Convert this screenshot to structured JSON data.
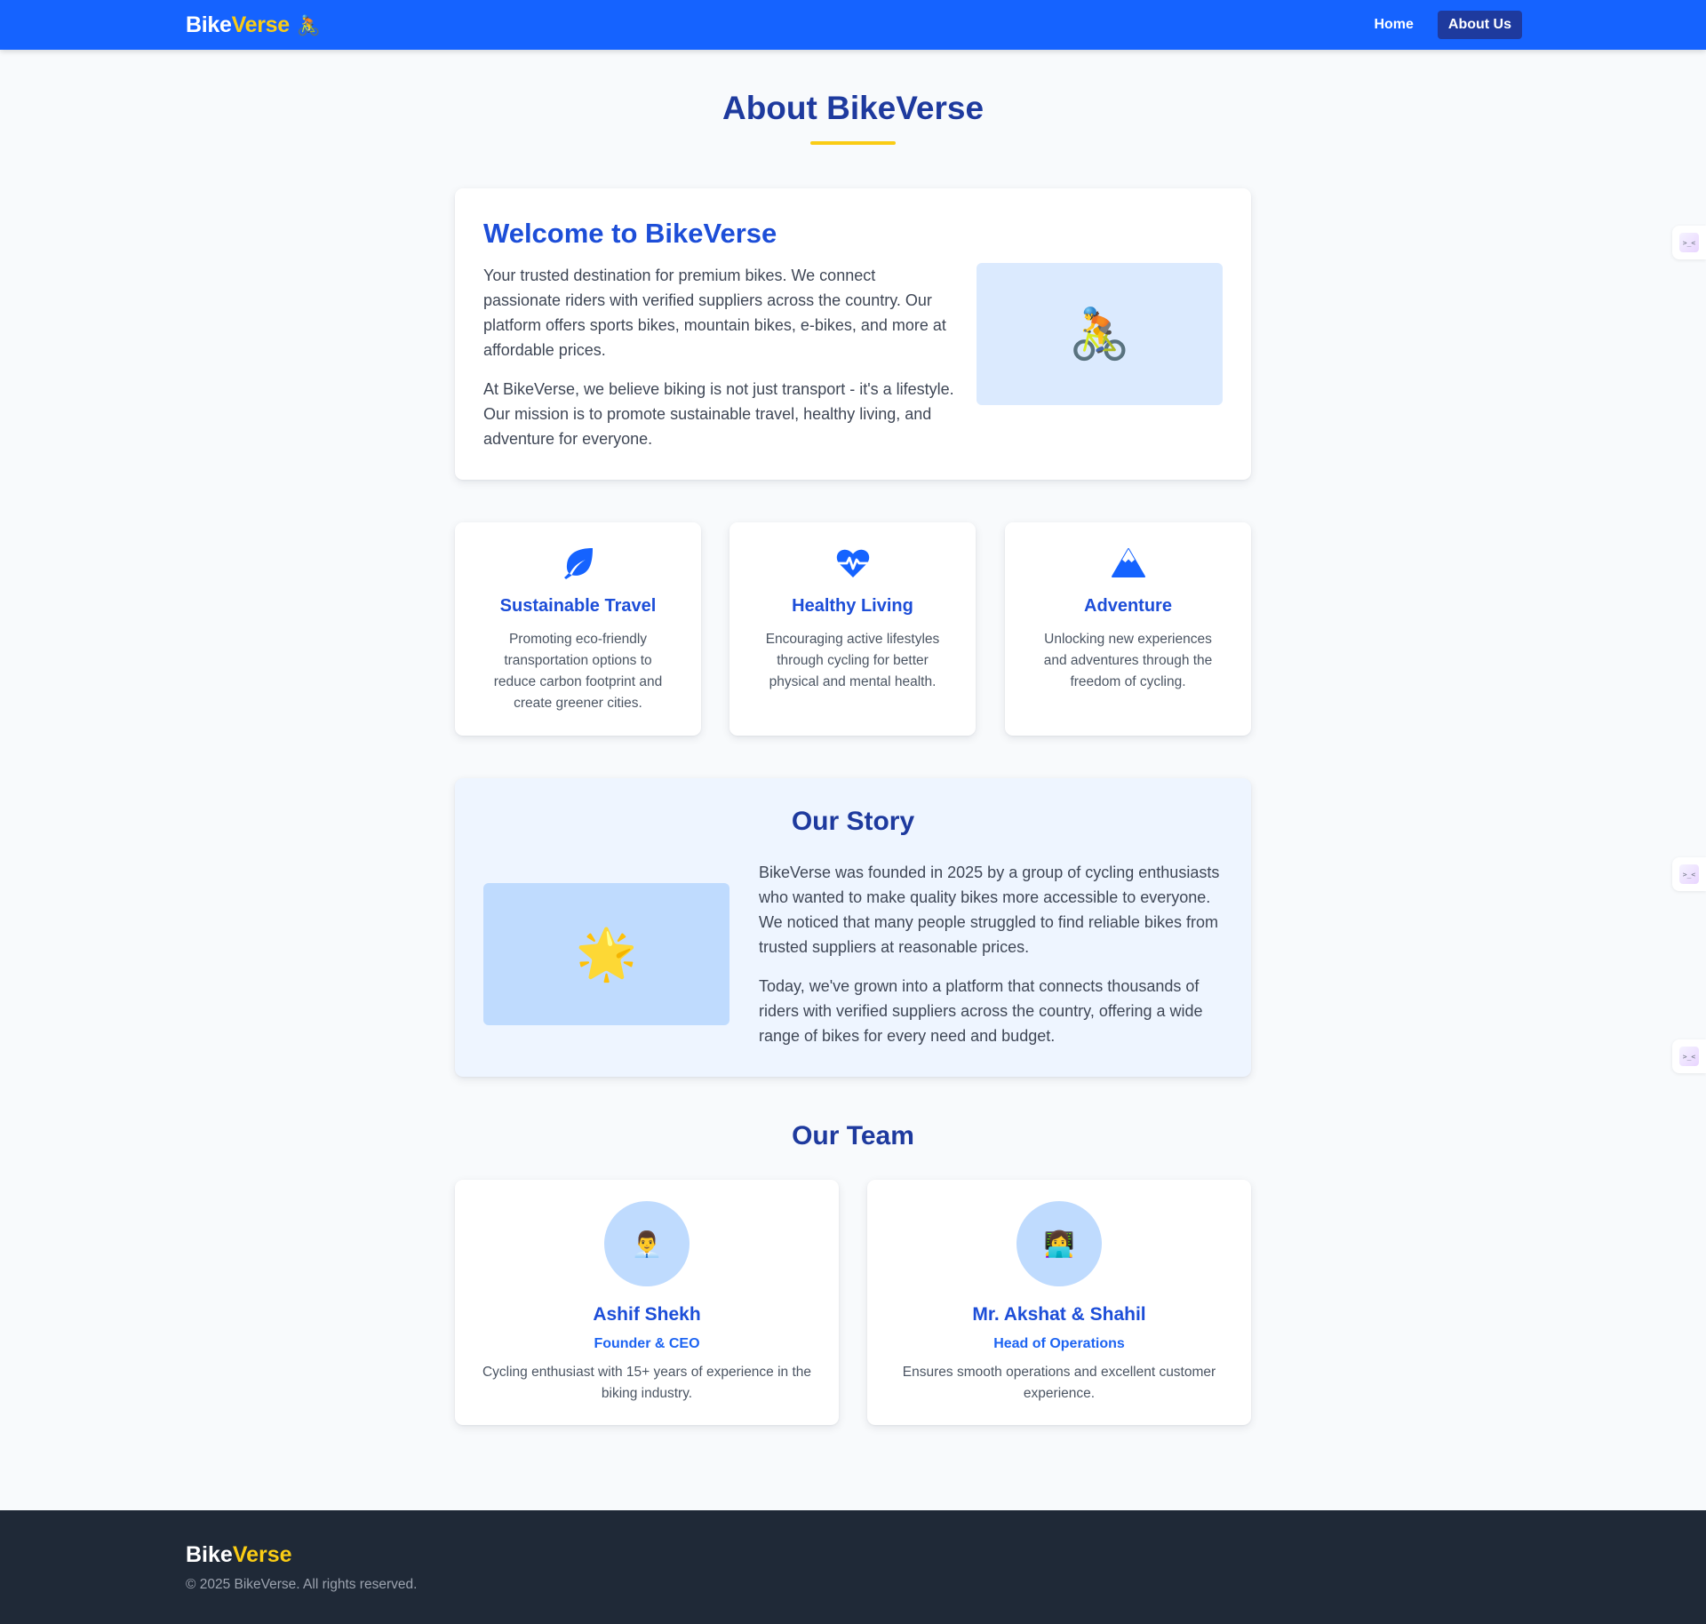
{
  "navbar": {
    "brand_part1": "Bike",
    "brand_part2": "Verse",
    "brand_emoji": "🚴",
    "links": [
      {
        "label": "Home",
        "active": false
      },
      {
        "label": "About Us",
        "active": true
      }
    ]
  },
  "page": {
    "title": "About BikeVerse"
  },
  "welcome": {
    "title": "Welcome to BikeVerse",
    "paragraph1": "Your trusted destination for premium bikes. We connect passionate riders with verified suppliers across the country. Our platform offers sports bikes, mountain bikes, e-bikes, and more at affordable prices.",
    "paragraph2": "At BikeVerse, we believe biking is not just transport - it's a lifestyle. Our mission is to promote sustainable travel, healthy living, and adventure for everyone.",
    "image_emoji": "🚴"
  },
  "values": [
    {
      "icon": "leaf-icon",
      "title": "Sustainable Travel",
      "description": "Promoting eco-friendly transportation options to reduce carbon footprint and create greener cities."
    },
    {
      "icon": "heartbeat-icon",
      "title": "Healthy Living",
      "description": "Encouraging active lifestyles through cycling for better physical and mental health."
    },
    {
      "icon": "mountain-icon",
      "title": "Adventure",
      "description": "Unlocking new experiences and adventures through the freedom of cycling."
    }
  ],
  "story": {
    "title": "Our Story",
    "paragraph1": "BikeVerse was founded in 2025 by a group of cycling enthusiasts who wanted to make quality bikes more accessible to everyone. We noticed that many people struggled to find reliable bikes from trusted suppliers at reasonable prices.",
    "paragraph2": "Today, we've grown into a platform that connects thousands of riders with verified suppliers across the country, offering a wide range of bikes for every need and budget.",
    "image_emoji": "🌟"
  },
  "team": {
    "title": "Our Team",
    "members": [
      {
        "avatar": "👨‍💼",
        "name": "Ashif Shekh",
        "role": "Founder & CEO",
        "description": "Cycling enthusiast with 15+ years of experience in the biking industry."
      },
      {
        "avatar": "👩‍💻",
        "name": "Mr. Akshat & Shahil",
        "role": "Head of Operations",
        "description": "Ensures smooth operations and excellent customer experience."
      }
    ]
  },
  "footer": {
    "brand_part1": "Bike",
    "brand_part2": "Verse",
    "copyright": "© 2025 BikeVerse. All rights reserved."
  },
  "colors": {
    "primary": "#1563ff",
    "navy": "#1e3a9e",
    "accent": "#facc15",
    "footer_bg": "#1f2937"
  }
}
